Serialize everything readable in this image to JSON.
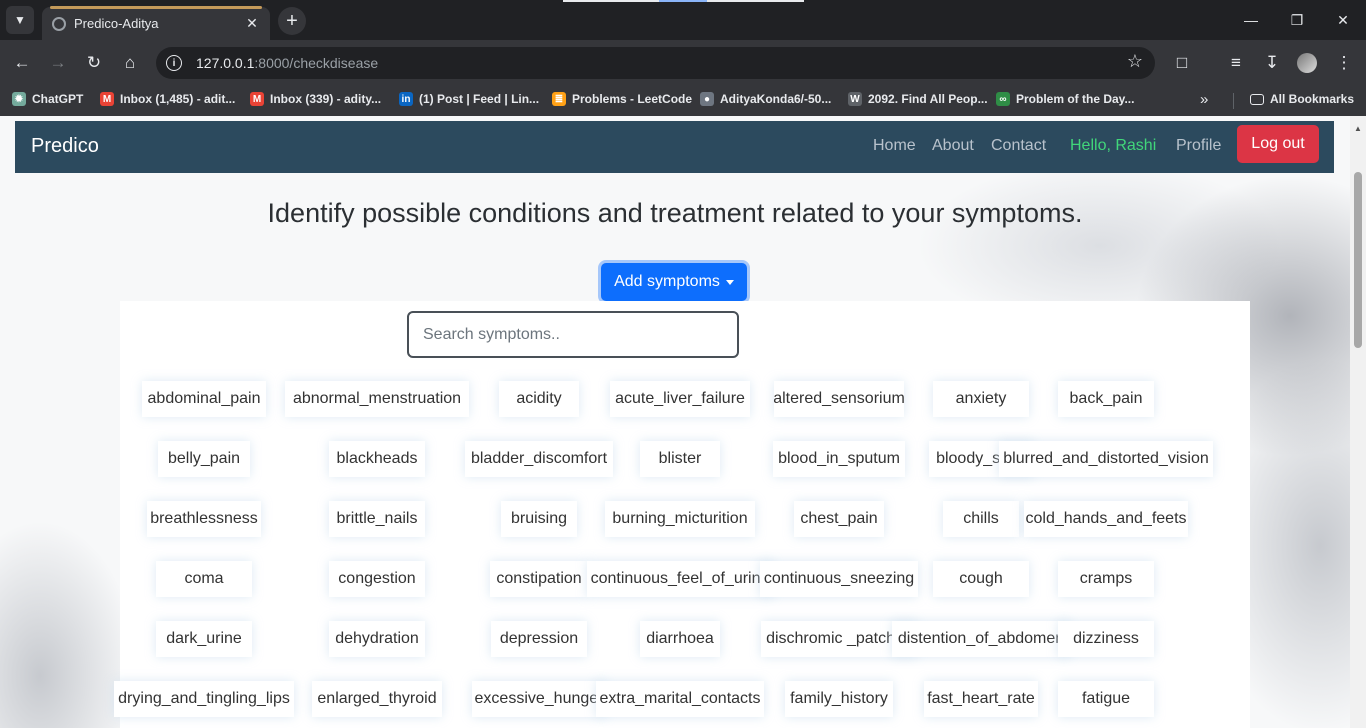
{
  "browser": {
    "tab_title": "Predico-Aditya",
    "url_host": "127.0.0.1",
    "url_rest": ":8000/checkdisease",
    "bookmarks": [
      {
        "label": "ChatGPT",
        "color": "#74aa9c"
      },
      {
        "label": "Inbox (1,485) - adit...",
        "color": "#ea4335"
      },
      {
        "label": "Inbox (339) - adity...",
        "color": "#ea4335"
      },
      {
        "label": "(1) Post | Feed | Lin...",
        "color": "#0a66c2"
      },
      {
        "label": "Problems - LeetCode",
        "color": "#ffa116"
      },
      {
        "label": "AdityaKonda6/-50...",
        "color": "#6e7681"
      },
      {
        "label": "2092. Find All Peop...",
        "color": "#5f6368"
      },
      {
        "label": "Problem of the Day...",
        "color": "#2f8d46"
      }
    ],
    "all_bookmarks": "All Bookmarks"
  },
  "navbar": {
    "brand": "Predico",
    "links": [
      "Home",
      "About",
      "Contact"
    ],
    "greeting": "Hello, Rashi",
    "profile": "Profile",
    "logout": "Log out"
  },
  "main": {
    "heading": "Identify possible conditions and treatment related to your symptoms.",
    "add_button": "Add symptoms",
    "search_placeholder": "Search symptoms.."
  },
  "symptoms": [
    [
      "abdominal_pain",
      "abnormal_menstruation",
      "acidity",
      "acute_liver_failure",
      "altered_sensorium",
      "anxiety",
      "back_pain"
    ],
    [
      "belly_pain",
      "blackheads",
      "bladder_discomfort",
      "blister",
      "blood_in_sputum",
      "bloody_stool",
      "blurred_and_distorted_vision"
    ],
    [
      "breathlessness",
      "brittle_nails",
      "bruising",
      "burning_micturition",
      "chest_pain",
      "chills",
      "cold_hands_and_feets"
    ],
    [
      "coma",
      "congestion",
      "constipation",
      "continuous_feel_of_urine",
      "continuous_sneezing",
      "cough",
      "cramps"
    ],
    [
      "dark_urine",
      "dehydration",
      "depression",
      "diarrhoea",
      "dischromic _patches",
      "distention_of_abdomen",
      "dizziness"
    ],
    [
      "drying_and_tingling_lips",
      "enlarged_thyroid",
      "excessive_hunger",
      "extra_marital_contacts",
      "family_history",
      "fast_heart_rate",
      "fatigue"
    ]
  ],
  "colors": {
    "navbar_bg": "#2c4a5e",
    "greeting": "#41d67a",
    "logout_bg": "#dc3545",
    "primary": "#0d6efd"
  }
}
